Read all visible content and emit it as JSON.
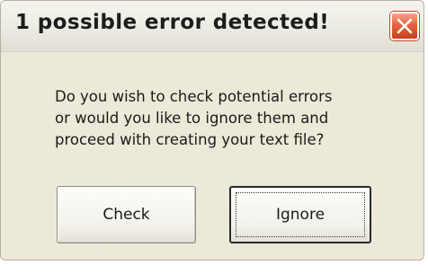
{
  "dialog": {
    "title": "1 possible error detected!",
    "close_icon": "close-icon",
    "accent_close": "#e2643f",
    "message_lines": [
      "Do you wish to check potential errors",
      "or would you like to ignore them and",
      "proceed with creating your text file?"
    ],
    "buttons": {
      "check_label": "Check",
      "ignore_label": "Ignore"
    }
  }
}
